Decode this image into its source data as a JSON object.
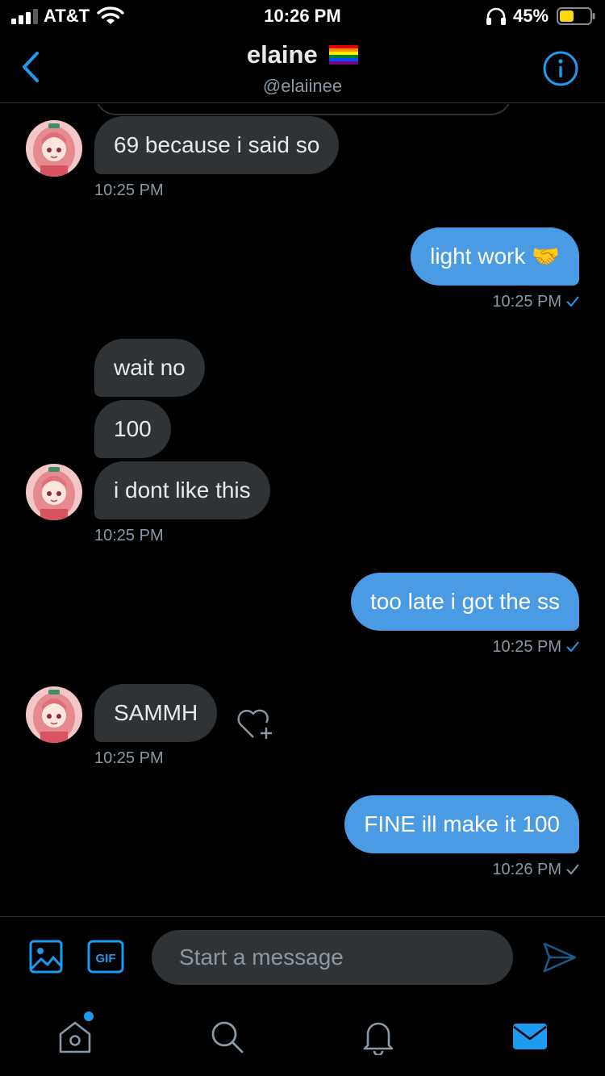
{
  "status_bar": {
    "carrier": "AT&T",
    "time": "10:26 PM",
    "battery": "45%"
  },
  "header": {
    "name": "elaine",
    "handle": "@elaiinee"
  },
  "messages": [
    {
      "from": "them",
      "text": "69 because i said so"
    },
    {
      "from": "them",
      "timestamp": "10:25 PM"
    },
    {
      "from": "me",
      "text": "light work 🤝",
      "timestamp": "10:25 PM"
    },
    {
      "from": "them",
      "text": "wait no"
    },
    {
      "from": "them",
      "text": "100"
    },
    {
      "from": "them",
      "text": "i dont like this",
      "timestamp": "10:25 PM"
    },
    {
      "from": "me",
      "text": "too late i got the ss",
      "timestamp": "10:25 PM"
    },
    {
      "from": "them",
      "text": "SAMMH",
      "timestamp": "10:25 PM"
    },
    {
      "from": "me",
      "text": "FINE ill make it 100",
      "timestamp": "10:26 PM"
    }
  ],
  "composer": {
    "placeholder": "Start a message"
  },
  "icons": {
    "back": "chevron-left-icon",
    "info": "info-icon",
    "react": "heart-plus-icon",
    "image": "image-icon",
    "gif": "gif-icon",
    "send": "send-icon",
    "home": "home-icon",
    "search": "search-icon",
    "notifications": "bell-icon",
    "messages": "mail-icon"
  },
  "colors": {
    "accent": "#1d9bf0",
    "outgoing_bubble": "#4a9be4",
    "incoming_bubble": "#2f3336",
    "background": "#000000",
    "muted_text": "#8b98a5"
  }
}
